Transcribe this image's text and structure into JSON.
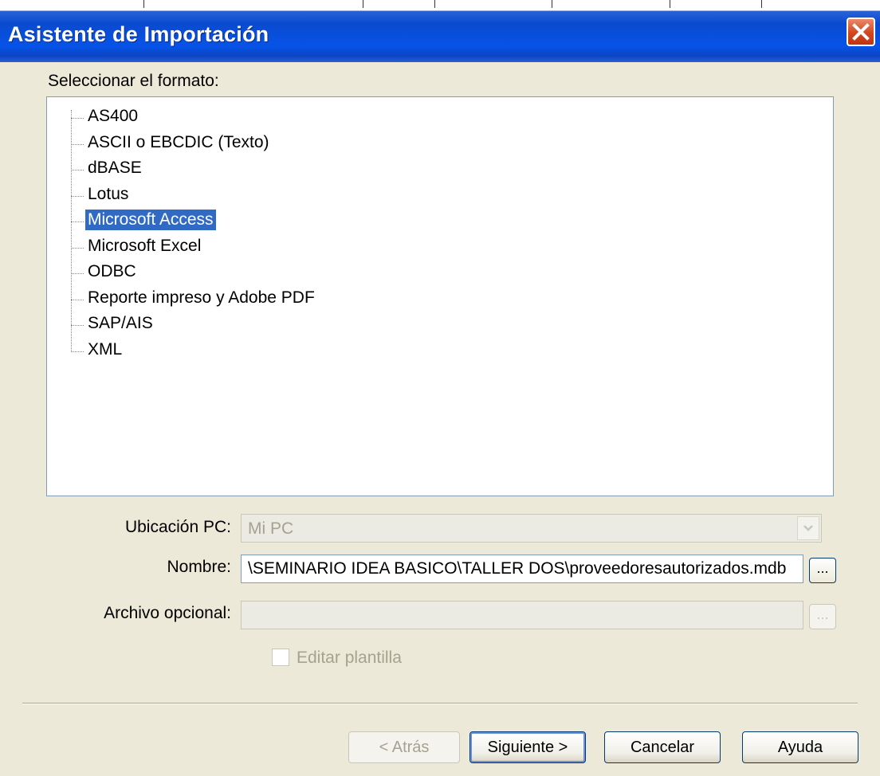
{
  "window": {
    "title": "Asistente de Importación"
  },
  "format_section": {
    "label": "Seleccionar el formato:",
    "items": [
      {
        "label": "AS400",
        "selected": false
      },
      {
        "label": "ASCII o EBCDIC (Texto)",
        "selected": false
      },
      {
        "label": "dBASE",
        "selected": false
      },
      {
        "label": "Lotus",
        "selected": false
      },
      {
        "label": "Microsoft Access",
        "selected": true
      },
      {
        "label": "Microsoft Excel",
        "selected": false
      },
      {
        "label": "ODBC",
        "selected": false
      },
      {
        "label": "Reporte impreso y Adobe PDF",
        "selected": false
      },
      {
        "label": "SAP/AIS",
        "selected": false
      },
      {
        "label": "XML",
        "selected": false
      }
    ]
  },
  "location": {
    "label": "Ubicación PC:",
    "value": "Mi PC",
    "enabled": false
  },
  "name": {
    "label": "Nombre:",
    "value": "\\SEMINARIO IDEA BASICO\\TALLER DOS\\proveedoresautorizados.mdb",
    "browse_label": "..."
  },
  "optional_file": {
    "label": "Archivo opcional:",
    "value": "",
    "browse_label": "...",
    "enabled": false
  },
  "edit_template": {
    "label": "Editar plantilla",
    "checked": false,
    "enabled": false
  },
  "buttons": {
    "back": "< Atrás",
    "next": "Siguiente >",
    "cancel": "Cancelar",
    "help": "Ayuda"
  },
  "colors": {
    "titlebar": "#0a4ad0",
    "selection": "#316ac5",
    "dialog_bg": "#ece9d8"
  },
  "icons": {
    "close": "close-icon",
    "dropdown": "chevron-down-icon"
  }
}
